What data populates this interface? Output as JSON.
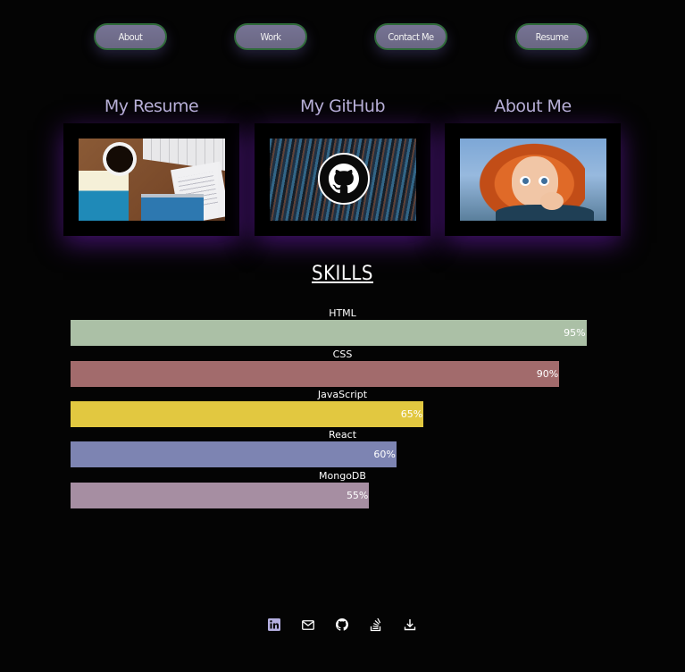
{
  "nav": {
    "items": [
      {
        "label": "About"
      },
      {
        "label": "Work"
      },
      {
        "label": "Contact Me"
      },
      {
        "label": "Resume"
      }
    ]
  },
  "cards": [
    {
      "title": "My Resume",
      "image": "resume-desk-photo"
    },
    {
      "title": "My GitHub",
      "image": "github-code-photo"
    },
    {
      "title": "About Me",
      "image": "merida-portrait"
    }
  ],
  "skills": {
    "title": "SKILLS",
    "items": [
      {
        "name": "HTML",
        "percent_label": "95%",
        "percent": 95,
        "color": "#abc0a6"
      },
      {
        "name": "CSS",
        "percent_label": "90%",
        "percent": 90,
        "color": "#a26b6c"
      },
      {
        "name": "JavaScript",
        "percent_label": "65%",
        "percent": 65,
        "color": "#e2c840"
      },
      {
        "name": "React",
        "percent_label": "60%",
        "percent": 60,
        "color": "#7d84b2"
      },
      {
        "name": "MongoDB",
        "percent_label": "55%",
        "percent": 55,
        "color": "#a68ea2"
      }
    ]
  },
  "footer": {
    "icons": [
      {
        "name": "linkedin-icon"
      },
      {
        "name": "email-icon"
      },
      {
        "name": "github-icon"
      },
      {
        "name": "stackoverflow-icon"
      },
      {
        "name": "download-icon"
      }
    ]
  },
  "theme": {
    "background": "#040404",
    "nav_button": "#706d8c",
    "nav_border": "#2f6a3a",
    "card_title": "#b9b2d8",
    "card_glow": "#7820c8",
    "icon_color": "#b4afe0"
  }
}
